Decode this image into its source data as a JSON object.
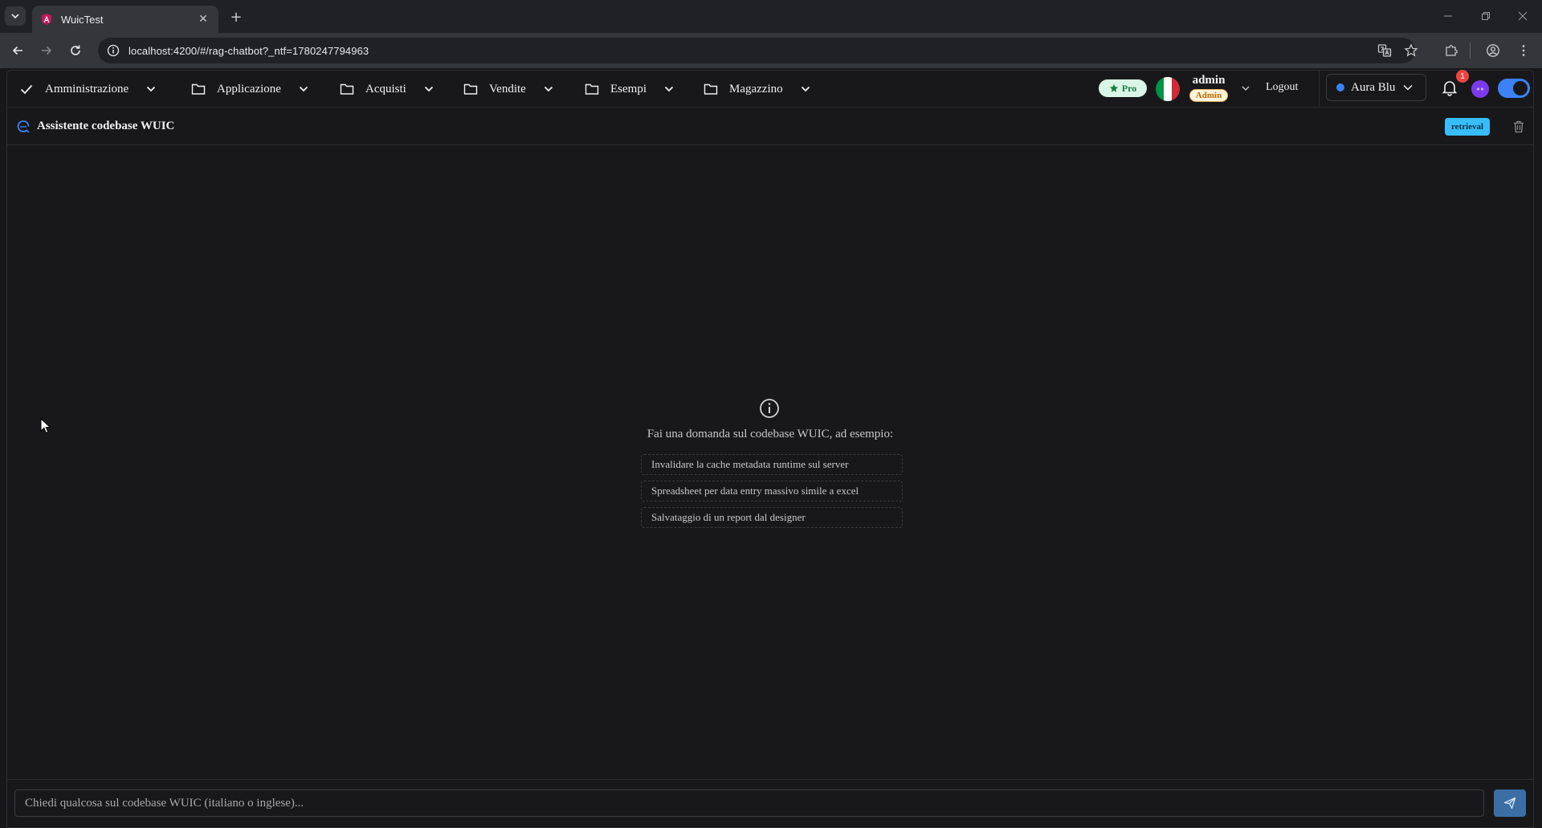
{
  "browser": {
    "tab_title": "WuicTest",
    "tab_close": "✕",
    "new_tab": "+",
    "url": "localhost:4200/#/rag-chatbot?_ntf=1780247794963"
  },
  "menubar": {
    "items": [
      {
        "label": "Amministrazione",
        "icon": "check-icon"
      },
      {
        "label": "Applicazione",
        "icon": "folder-icon"
      },
      {
        "label": "Acquisti",
        "icon": "folder-icon"
      },
      {
        "label": "Vendite",
        "icon": "folder-icon"
      },
      {
        "label": "Esempi",
        "icon": "folder-icon"
      },
      {
        "label": "Magazzino",
        "icon": "folder-icon"
      }
    ],
    "pro_badge": "Pro",
    "user": {
      "name": "admin",
      "role": "Admin"
    },
    "logout": "Logout",
    "theme": "Aura Blue",
    "notifications_count": "1",
    "dark_mode_on": true
  },
  "chat": {
    "title": "Assistente codebase WUIC",
    "mode_badge": "retrieval",
    "empty_hint": "Fai una domanda sul codebase WUIC, ad esempio:",
    "suggestions": [
      "Invalidare la cache metadata runtime sul server",
      "Spreadsheet per data entry massivo simile a excel",
      "Salvataggio di un report dal designer"
    ],
    "input_placeholder": "Chiedi qualcosa sul codebase WUIC (italiano o inglese)..."
  },
  "colors": {
    "accent": "#3b82f6",
    "badge_retrieval": "#38bdf8",
    "pro_badge_bg": "#d9f5e5",
    "notification": "#ef4444",
    "background": "#18181a"
  }
}
